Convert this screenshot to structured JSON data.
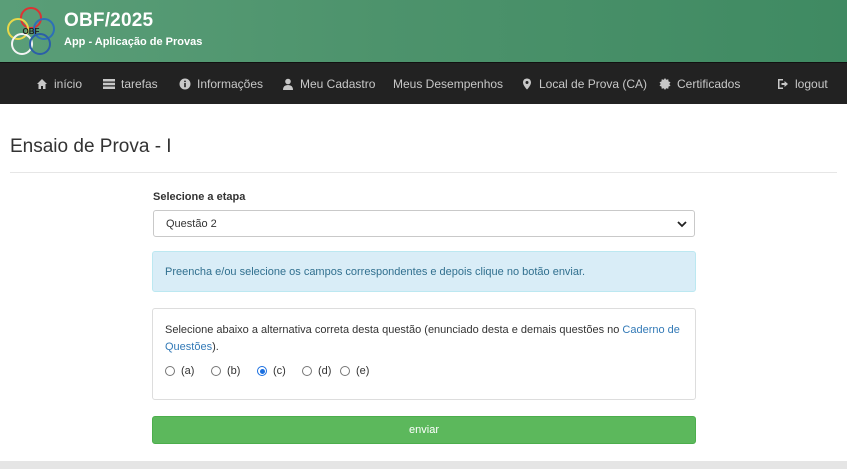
{
  "header": {
    "logo_text": "OBF",
    "title": "OBF/2025",
    "subtitle": "App - Aplicação de Provas"
  },
  "nav": {
    "items": [
      {
        "label": "início",
        "icon": "home-icon"
      },
      {
        "label": "tarefas",
        "icon": "tasks-icon"
      },
      {
        "label": "Informações",
        "icon": "info-icon"
      },
      {
        "label": "Meu Cadastro",
        "icon": "user-icon"
      },
      {
        "label": "Meus Desempenhos",
        "icon": ""
      },
      {
        "label": "Local de Prova (CA)",
        "icon": "map-marker-icon"
      },
      {
        "label": "Certificados",
        "icon": "certificate-icon"
      },
      {
        "label": "logout",
        "icon": "logout-icon"
      }
    ]
  },
  "page": {
    "title": "Ensaio de Prova - I"
  },
  "form": {
    "stage_label": "Selecione a etapa",
    "stage_value": "Questão 2",
    "info_message": "Preencha e/ou selecione os campos correspondentes e depois clique no botão enviar.",
    "question_text_before": "Selecione abaixo a alternativa correta desta questão (enunciado desta e demais questões no ",
    "question_link": "Caderno de Questões",
    "question_text_after": ").",
    "options": [
      "(a)",
      "(b)",
      "(c)",
      "(d)",
      "(e)"
    ],
    "selected_option": "(c)",
    "submit_label": "enviar"
  },
  "colors": {
    "header_green": "#4d936c",
    "navbar": "#222222",
    "info_bg": "#d9edf7",
    "info_text": "#31708f",
    "submit": "#5cb85c",
    "link": "#337ab7"
  }
}
